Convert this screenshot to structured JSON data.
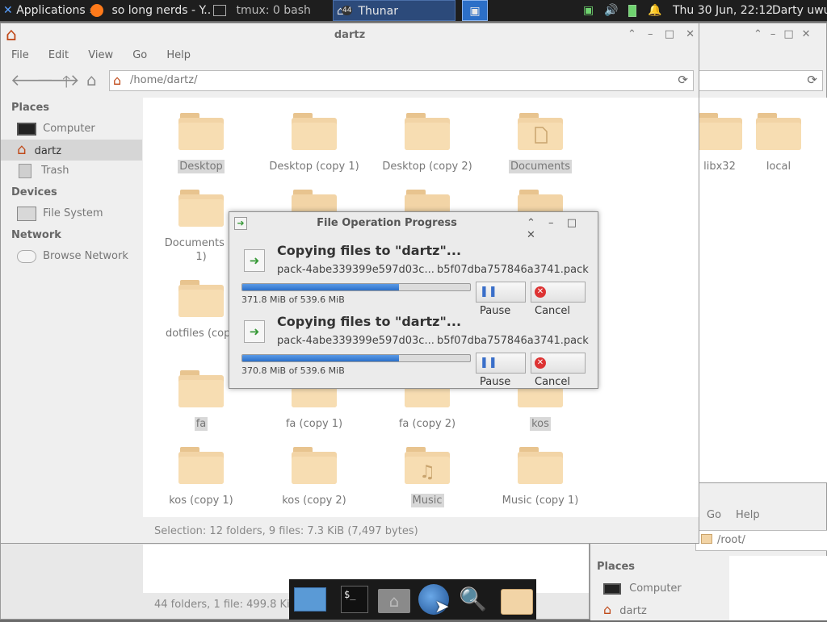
{
  "panel": {
    "applications": "Applications",
    "applications_suffix": "≡",
    "task_browser": "so long nerds - Y...",
    "task_terminal": "tmux: 0 bash",
    "task_thunar": "Thunar",
    "task_badge": "44",
    "clock": "Thu 30 Jun, 22:12",
    "user": "Darty uwu"
  },
  "main_window": {
    "title": "dartz",
    "menu": [
      "File",
      "Edit",
      "View",
      "Go",
      "Help"
    ],
    "location": "/home/dartz/",
    "sidebar": {
      "places_heading": "Places",
      "devices_heading": "Devices",
      "network_heading": "Network",
      "computer": "Computer",
      "home": "dartz",
      "trash": "Trash",
      "filesystem": "File System",
      "browse_network": "Browse Network"
    },
    "folders": {
      "f0": "Desktop",
      "f1": "Desktop (copy 1)",
      "f2": "Desktop (copy 2)",
      "f3": "Documents",
      "f4a": "Documents (c",
      "f4b": "1)",
      "f8": "dotfiles (copy",
      "f12": "fa",
      "f13": "fa (copy 1)",
      "f14": "fa (copy 2)",
      "f15": "kos",
      "f16": "kos (copy 1)",
      "f17": "kos (copy 2)",
      "f18": "Music",
      "f19": "Music (copy 1)"
    },
    "status": "Selection: 12 folders, 9 files: 7.3 KiB (7,497 bytes)"
  },
  "right_window": {
    "folder_a": "libx32",
    "folder_b": "local"
  },
  "lower_window": {
    "menu_go": "Go",
    "menu_help": "Help",
    "location": "/root/",
    "places_heading": "Places",
    "computer": "Computer",
    "home": "dartz"
  },
  "back_window": {
    "status": "44 folders, 1 file: 499.8 KiB"
  },
  "dialog": {
    "title": "File Operation Progress",
    "ops": [
      {
        "heading": "Copying files to \"dartz\"...",
        "file_left": "pack-4abe339399e597d03c...",
        "file_right": "b5f07dba757846a3741.pack",
        "progress_text": "371.8 MiB of 539.6 MiB",
        "progress": 0.689,
        "pause": "Pause",
        "cancel": "Cancel"
      },
      {
        "heading": "Copying files to \"dartz\"...",
        "file_left": "pack-4abe339399e597d03c...",
        "file_right": "b5f07dba757846a3741.pack",
        "progress_text": "370.8 MiB of 539.6 MiB",
        "progress": 0.687,
        "pause": "Pause",
        "cancel": "Cancel"
      }
    ]
  },
  "colors": {
    "progress_fill": "#2b70c9",
    "panel_bg": "#1e1e1e",
    "folder": "#f2d4a6"
  }
}
